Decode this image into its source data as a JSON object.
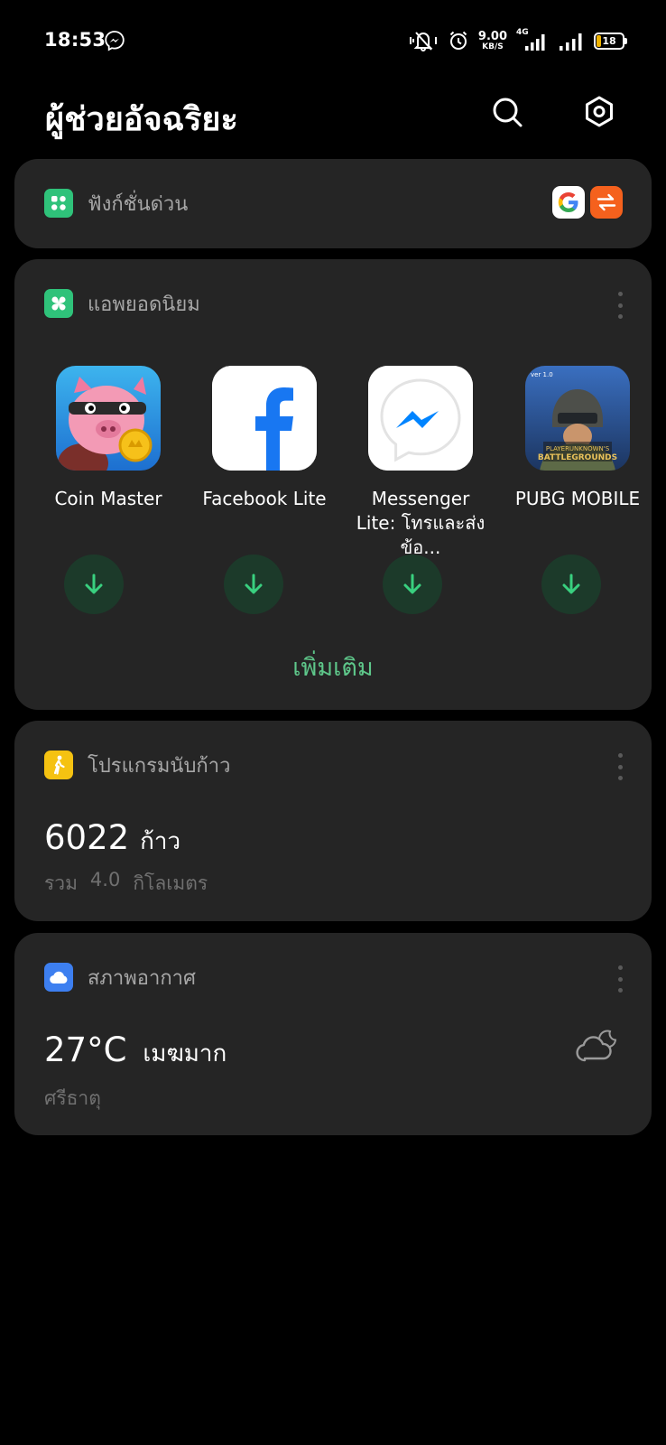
{
  "status_bar": {
    "time": "18:53",
    "speed_value": "9.00",
    "speed_unit": "KB/S",
    "network": "4G",
    "battery": "18",
    "battery_level": 0.18,
    "battery_color": "#f0b400"
  },
  "header": {
    "title": "ผู้ช่วยอัจฉริยะ",
    "search_icon": "search-icon",
    "settings_icon": "settings-icon"
  },
  "quick_functions": {
    "title": "ฟังก์ชั่นด่วน",
    "icon": "quick-function-icon",
    "icon_color": "#2fc27a",
    "apps": [
      {
        "icon": "google-icon"
      },
      {
        "icon": "transfer-icon",
        "color": "#f5611d"
      }
    ]
  },
  "popular_apps": {
    "title": "แอพยอดนิยม",
    "icon": "popular-apps-icon",
    "icon_color": "#2fc27a",
    "apps": [
      {
        "name": "Coin Master",
        "icon": "coin-master-icon"
      },
      {
        "name": "Facebook Lite",
        "icon": "facebook-icon"
      },
      {
        "name": "Messenger Lite: โทรและส่งข้อ...",
        "icon": "messenger-icon"
      },
      {
        "name": "PUBG MOBILE",
        "icon": "pubg-icon"
      }
    ],
    "more_label": "เพิ่มเติม",
    "accent": "#5ec78a"
  },
  "step_counter": {
    "title": "โปรแกรมนับก้าว",
    "icon": "walking-icon",
    "icon_color": "#f5c211",
    "steps": "6022",
    "steps_unit": "ก้าว",
    "total_label": "รวม",
    "distance": "4.0",
    "distance_unit": "กิโลเมตร"
  },
  "weather": {
    "title": "สภาพอากาศ",
    "icon": "weather-icon",
    "icon_color": "#3d7ff0",
    "temperature": "27°C",
    "condition": "เมฆมาก",
    "location": "ศรีธาตุ",
    "condition_icon": "cloudy-night-icon"
  }
}
